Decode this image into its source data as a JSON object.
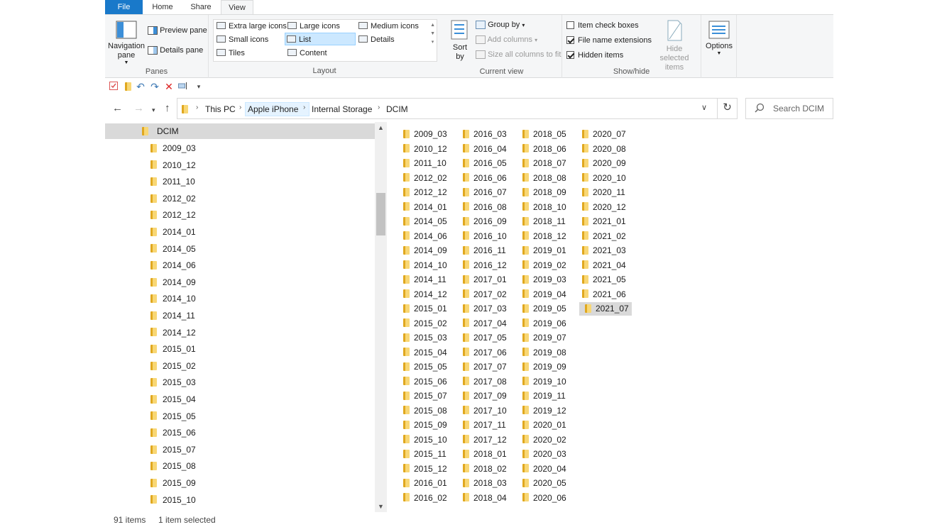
{
  "ribbon_tabs": [
    "File",
    "Home",
    "Share",
    "View"
  ],
  "active_tab": "View",
  "panes": {
    "navigation_pane": "Navigation pane",
    "preview_pane": "Preview pane",
    "details_pane": "Details pane",
    "group_label": "Panes"
  },
  "layout": {
    "items": [
      "Extra large icons",
      "Large icons",
      "Medium icons",
      "Small icons",
      "List",
      "Details",
      "Tiles",
      "Content"
    ],
    "selected": "List",
    "group_label": "Layout"
  },
  "current_view": {
    "sort_by": "Sort by",
    "group_by": "Group by",
    "add_columns": "Add columns",
    "size_all_columns": "Size all columns to fit",
    "group_label": "Current view"
  },
  "show_hide": {
    "item_check_boxes": "Item check boxes",
    "item_check_boxes_checked": false,
    "file_name_extensions": "File name extensions",
    "file_name_extensions_checked": true,
    "hidden_items": "Hidden items",
    "hidden_items_checked": true,
    "hide_selected_items": "Hide selected items",
    "group_label": "Show/hide"
  },
  "options": "Options",
  "breadcrumb": [
    "This PC",
    "Apple iPhone",
    "Internal Storage",
    "DCIM"
  ],
  "search_placeholder": "Search DCIM",
  "tree": {
    "root": "DCIM",
    "items": [
      "2009_03",
      "2010_12",
      "2011_10",
      "2012_02",
      "2012_12",
      "2014_01",
      "2014_05",
      "2014_06",
      "2014_09",
      "2014_10",
      "2014_11",
      "2014_12",
      "2015_01",
      "2015_02",
      "2015_03",
      "2015_04",
      "2015_05",
      "2015_06",
      "2015_07",
      "2015_08",
      "2015_09",
      "2015_10"
    ]
  },
  "folders": [
    [
      "2009_03",
      "2010_12",
      "2011_10",
      "2012_02",
      "2012_12",
      "2014_01",
      "2014_05",
      "2014_06",
      "2014_09",
      "2014_10",
      "2014_11",
      "2014_12",
      "2015_01",
      "2015_02",
      "2015_03",
      "2015_04",
      "2015_05",
      "2015_06",
      "2015_07",
      "2015_08",
      "2015_09",
      "2015_10",
      "2015_11",
      "2015_12",
      "2016_01",
      "2016_02"
    ],
    [
      "2016_03",
      "2016_04",
      "2016_05",
      "2016_06",
      "2016_07",
      "2016_08",
      "2016_09",
      "2016_10",
      "2016_11",
      "2016_12",
      "2017_01",
      "2017_02",
      "2017_03",
      "2017_04",
      "2017_05",
      "2017_06",
      "2017_07",
      "2017_08",
      "2017_09",
      "2017_10",
      "2017_11",
      "2017_12",
      "2018_01",
      "2018_02",
      "2018_03",
      "2018_04"
    ],
    [
      "2018_05",
      "2018_06",
      "2018_07",
      "2018_08",
      "2018_09",
      "2018_10",
      "2018_11",
      "2018_12",
      "2019_01",
      "2019_02",
      "2019_03",
      "2019_04",
      "2019_05",
      "2019_06",
      "2019_07",
      "2019_08",
      "2019_09",
      "2019_10",
      "2019_11",
      "2019_12",
      "2020_01",
      "2020_02",
      "2020_03",
      "2020_04",
      "2020_05",
      "2020_06"
    ],
    [
      "2020_07",
      "2020_08",
      "2020_09",
      "2020_10",
      "2020_11",
      "2020_12",
      "2021_01",
      "2021_02",
      "2021_03",
      "2021_04",
      "2021_05",
      "2021_06",
      "2021_07"
    ]
  ],
  "selected_folder": "2021_07",
  "status": {
    "item_count": "91 items",
    "selection": "1 item selected"
  }
}
